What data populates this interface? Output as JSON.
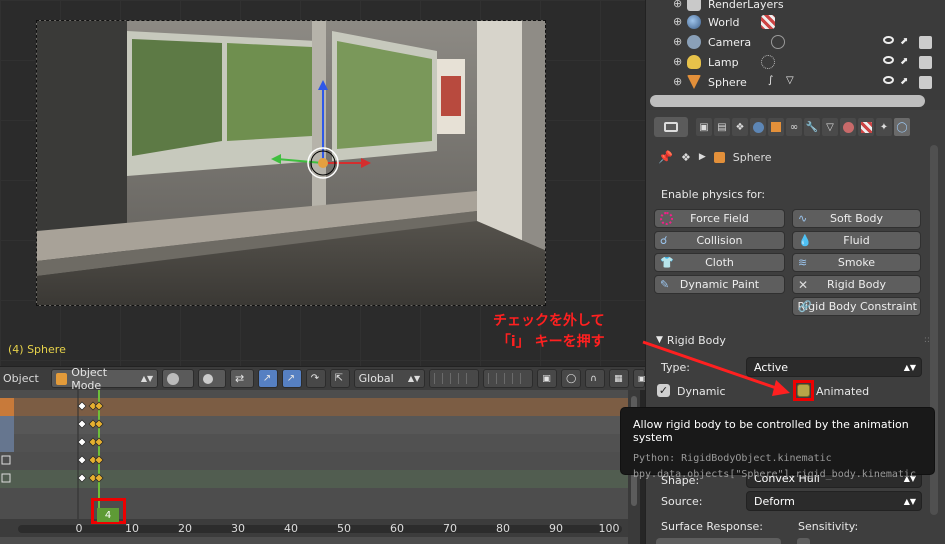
{
  "viewport": {
    "frame_object_label": "(4) Sphere"
  },
  "header3d": {
    "editor_label": "Object",
    "mode": "Object Mode",
    "orientation": "Global"
  },
  "timeline": {
    "current_frame": "4",
    "ruler_ticks": [
      "0",
      "10",
      "20",
      "30",
      "40",
      "50",
      "60",
      "70",
      "80",
      "90",
      "100"
    ]
  },
  "outliner": {
    "items": [
      {
        "label": "RenderLayers"
      },
      {
        "label": "World"
      },
      {
        "label": "Camera"
      },
      {
        "label": "Lamp"
      },
      {
        "label": "Sphere"
      }
    ]
  },
  "properties": {
    "object_name": "Sphere",
    "enable_physics_label": "Enable physics for:",
    "physics_buttons": {
      "force_field": "Force Field",
      "soft_body": "Soft Body",
      "collision": "Collision",
      "fluid": "Fluid",
      "cloth": "Cloth",
      "smoke": "Smoke",
      "dynamic_paint": "Dynamic Paint",
      "rigid_body": "Rigid Body",
      "rigid_body_constraint": "Rigid Body Constraint"
    },
    "rigid_body_panel": {
      "title": "Rigid Body",
      "type_label": "Type:",
      "type_value": "Active",
      "dynamic_label": "Dynamic",
      "animated_label": "Animated",
      "shape_label": "Shape:",
      "shape_value": "Convex Hull",
      "source_label": "Source:",
      "source_value": "Deform",
      "surface_response_label": "Surface Response:",
      "sensitivity_label": "Sensitivity:"
    }
  },
  "annotation": {
    "line1": "チェックを外して",
    "line2": "「i」 キーを押す"
  },
  "tooltip": {
    "title": "Allow rigid body to be controlled by the animation system",
    "python_line1": "Python: RigidBodyObject.kinematic",
    "python_line2": "bpy.data.objects[\"Sphere\"].rigid_body.kinematic"
  },
  "colors": {
    "annotation_red": "#ff2020",
    "frame_indicator_green": "#5e9b35",
    "active_blue": "#5680c2"
  }
}
